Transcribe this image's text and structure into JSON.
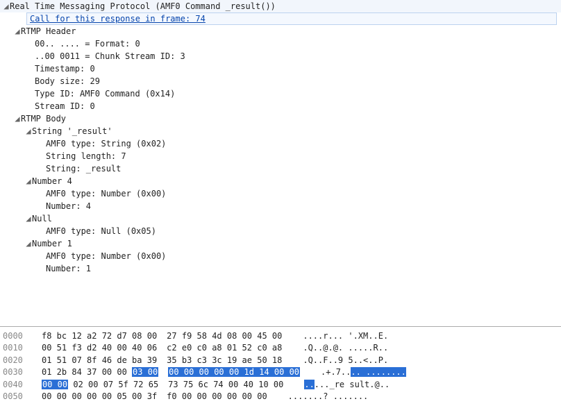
{
  "tree": {
    "root": {
      "label": "Real Time Messaging Protocol (AMF0 Command _result())",
      "call_link": "Call for this response in frame: 74"
    },
    "header": {
      "title": "RTMP Header",
      "lines": [
        "00.. .... = Format: 0",
        "..00 0011 = Chunk Stream ID: 3",
        "Timestamp: 0",
        "Body size: 29",
        "Type ID: AMF0 Command (0x14)",
        "Stream ID: 0"
      ]
    },
    "body": {
      "title": "RTMP Body",
      "items": [
        {
          "label": "String '_result'",
          "lines": [
            "AMF0 type: String (0x02)",
            "String length: 7",
            "String: _result"
          ]
        },
        {
          "label": "Number 4",
          "lines": [
            "AMF0 type: Number (0x00)",
            "Number: 4"
          ]
        },
        {
          "label": "Null",
          "lines": [
            "AMF0 type: Null (0x05)"
          ]
        },
        {
          "label": "Number 1",
          "lines": [
            "AMF0 type: Number (0x00)",
            "Number: 1"
          ]
        }
      ]
    }
  },
  "hex": {
    "rows": [
      {
        "off": "0000",
        "a": "f8 bc 12 a2 72 d7 08 00",
        "b": "27 f9 58 4d 08 00 45 00",
        "asc1": "....r...",
        "asc2": "'.XM..E."
      },
      {
        "off": "0010",
        "a": "00 51 f3 d2 40 00 40 06",
        "b": "c2 e0 c0 a8 01 52 c0 a8",
        "asc1": ".Q..@.@.",
        "asc2": ".....R.."
      },
      {
        "off": "0020",
        "a": "01 51 07 8f 46 de ba 39",
        "b": "35 b3 c3 3c 19 ae 50 18",
        "asc1": ".Q..F..9",
        "asc2": "5..<..P."
      },
      {
        "off": "0030",
        "a": "01 2b 84 37 00 00 ",
        "sel_a": "03 00",
        "sel_b": "00 00 00 00 00 1d 14 00 00",
        "asc1": ".+.7..",
        "sel_asc": ".. ........"
      },
      {
        "off": "0040",
        "a_sel": "00 00",
        "a_rest": " 02 00 07 5f 72 65",
        "b": "73 75 6c 74 00 40 10 00",
        "asc1_sel": "..",
        "asc1_rest": "..._re",
        "asc2": "sult.@.."
      },
      {
        "off": "0050",
        "a": "00 00 00 00 00 05 00 3f",
        "b": "f0 00 00 00 00 00 00",
        "asc1": ".......?",
        "asc2": "......."
      }
    ]
  }
}
